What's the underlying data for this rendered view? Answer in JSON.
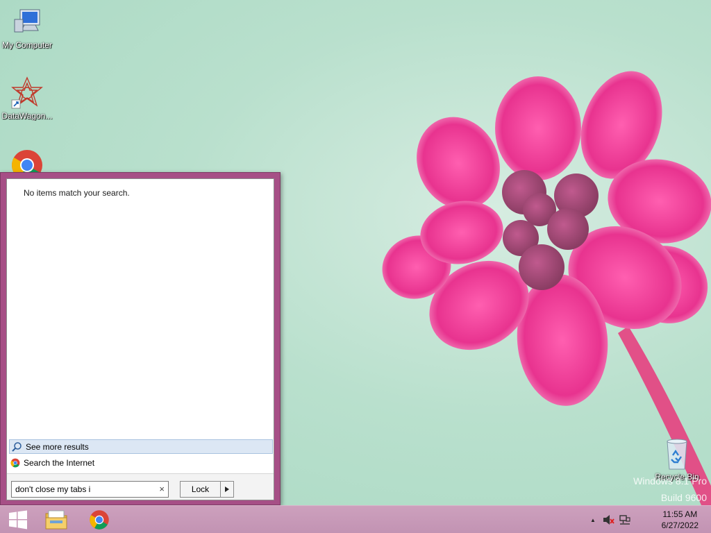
{
  "desktop": {
    "icons": [
      {
        "label": "My Computer",
        "icon": "computer-icon"
      },
      {
        "label": "DataWagon...",
        "icon": "datawagon-icon"
      },
      {
        "label": "",
        "icon": "chrome-icon"
      },
      {
        "label": "Recycle Bin",
        "icon": "recycle-bin-icon"
      }
    ],
    "watermark": {
      "line1": "Windows 8.1 Pro",
      "line2": "Build 9600"
    }
  },
  "start_menu": {
    "no_items_text": "No items match your search.",
    "see_more_label": "See more results",
    "search_internet_label": "Search the Internet",
    "search_value": "don't close my tabs i",
    "clear_glyph": "×",
    "lock_label": "Lock",
    "lock_arrow_glyph": "▸"
  },
  "taskbar": {
    "apps": [
      "start-icon",
      "file-explorer-icon",
      "chrome-icon"
    ],
    "tray_up_glyph": "▲",
    "clock": {
      "time": "11:55 AM",
      "date": "6/27/2022"
    }
  },
  "colors": {
    "start_menu_frame": "#a64f86",
    "taskbar": "#c697b6",
    "selection": "#dce7f4"
  }
}
